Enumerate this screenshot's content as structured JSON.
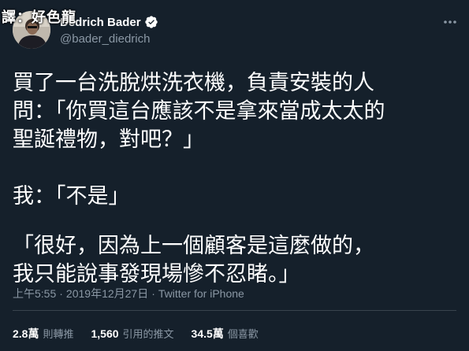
{
  "overlay": {
    "credit": "譯：好色龍"
  },
  "author": {
    "display_name": "Dedrich Bader",
    "handle": "@bader_diedrich",
    "verified_icon": "verified-badge-icon",
    "avatar_icon": "profile-photo"
  },
  "menu": {
    "icon": "more-dots-icon"
  },
  "tweet": {
    "lines": [
      "買了一台洗脫烘洗衣機，負責安裝的人",
      "問：「你買這台應該不是拿來當成太太的",
      "聖誕禮物，對吧？」",
      "我：「不是」",
      "「很好，因為上一個顧客是這麼做的，",
      "我只能說事發現場慘不忍睹。」"
    ]
  },
  "meta": {
    "time": "上午5:55",
    "separator": "·",
    "date": "2019年12月27日",
    "source": "Twitter for iPhone"
  },
  "stats": [
    {
      "value": "2.8萬",
      "label": "則轉推"
    },
    {
      "value": "1,560",
      "label": "引用的推文"
    },
    {
      "value": "34.5萬",
      "label": "個喜歡"
    }
  ],
  "colors": {
    "background": "#15202b",
    "text": "#ffffff",
    "secondary": "#8b98a5",
    "divider": "#38444d"
  }
}
